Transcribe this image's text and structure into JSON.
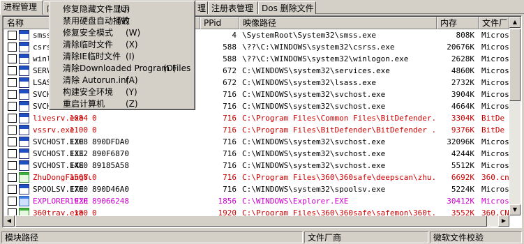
{
  "tabs": [
    {
      "label": "进程管理",
      "active": true
    },
    {
      "label": "内"
    },
    {
      "label": "理"
    },
    {
      "label": "注册表管理"
    },
    {
      "label": "Dos 删除文件"
    }
  ],
  "columns": [
    "名称",
    "PPid",
    "映像路径",
    "内存",
    "文件厂"
  ],
  "processes": [
    {
      "name": "smss.",
      "pid": "",
      "ppid": "4",
      "path": "\\SystemRoot\\System32\\smss.exe",
      "mem": "808K",
      "vendor": "Micros",
      "color": "#000000",
      "icon": "sys"
    },
    {
      "name": "csrss",
      "pid": "",
      "ppid": "588",
      "path": "\\??\\C:\\WINDOWS\\system32\\csrss.exe",
      "mem": "20676K",
      "vendor": "Micros",
      "color": "#000000",
      "icon": "sys"
    },
    {
      "name": "winlo",
      "pid": "",
      "ppid": "588",
      "path": "\\??\\C:\\WINDOWS\\system32\\winlogon.exe",
      "mem": "2628K",
      "vendor": "Micros",
      "color": "#000000",
      "icon": "sys"
    },
    {
      "name": "SERVI",
      "pid": "",
      "ppid": "672",
      "path": "C:\\WINDOWS\\system32\\services.exe",
      "mem": "4860K",
      "vendor": "Micros",
      "color": "#000000",
      "icon": "sys"
    },
    {
      "name": "LSASS",
      "pid": "",
      "ppid": "672",
      "path": "C:\\WINDOWS\\system32\\lsass.exe",
      "mem": "2732K",
      "vendor": "Micros",
      "color": "#000000",
      "icon": "sys"
    },
    {
      "name": "SVCHO",
      "pid": "",
      "ppid": "716",
      "path": "C:\\WINDOWS\\system32\\svchost.exe",
      "mem": "3904K",
      "vendor": "Micros",
      "color": "#000000",
      "icon": "sys"
    },
    {
      "name": "SVCHO",
      "pid": "",
      "ppid": "716",
      "path": "C:\\WINDOWS\\system32\\svchost.exe",
      "mem": "4664K",
      "vendor": "Micros",
      "color": "#000000",
      "icon": "sys"
    },
    {
      "name": "livesrv.exe",
      "pid": "1084",
      "handle": "0",
      "ppid": "716",
      "path": "C:\\Program Files\\Common Files\\BitDefender...",
      "mem": "3304K",
      "vendor": "BitDe",
      "color": "#cc0000",
      "icon": "sys"
    },
    {
      "name": "vssrv.exe",
      "pid": "1100",
      "handle": "0",
      "ppid": "716",
      "path": "C:\\Program Files\\BitDefender\\BitDefender ...",
      "mem": "9376K",
      "vendor": "BitDe",
      "color": "#cc0000",
      "icon": "sys"
    },
    {
      "name": "SVCHOST.EXE",
      "pid": "1208",
      "handle": "890DFDA0",
      "ppid": "716",
      "path": "C:\\WINDOWS\\system32\\svchost.exe",
      "mem": "32096K",
      "vendor": "Micros",
      "color": "#000000",
      "icon": "sys"
    },
    {
      "name": "SVCHOST.EXE",
      "pid": "1332",
      "handle": "890F6870",
      "ppid": "716",
      "path": "C:\\WINDOWS\\system32\\svchost.exe",
      "mem": "4244K",
      "vendor": "Micros",
      "color": "#000000",
      "icon": "sys"
    },
    {
      "name": "SVCHOST.EXE",
      "pid": "1480",
      "handle": "89185A58",
      "ppid": "716",
      "path": "C:\\WINDOWS\\system32\\svchost.exe",
      "mem": "5512K",
      "vendor": "Micros",
      "color": "#000000",
      "icon": "sys"
    },
    {
      "name": "ZhuDongFangYu.exe",
      "pid": "1508",
      "handle": "0",
      "ppid": "716",
      "path": "C:\\Program Files\\360\\360safe\\deepscan\\zhu...",
      "mem": "6692K",
      "vendor": "360.cn",
      "color": "#cc0000",
      "icon": "green"
    },
    {
      "name": "SPOOLSV.EXE",
      "pid": "1700",
      "handle": "890D46A0",
      "ppid": "716",
      "path": "C:\\WINDOWS\\system32\\spoolsv.exe",
      "mem": "5224K",
      "vendor": "Micros",
      "color": "#000000",
      "icon": "sys"
    },
    {
      "name": "EXPLORER.EXE",
      "pid": "1920",
      "handle": "89066248",
      "ppid": "1856",
      "path": "C:\\WINDOWS\\Explorer.EXE",
      "mem": "30412K",
      "vendor": "Micros",
      "color": "#cc00cc",
      "icon": "blue"
    },
    {
      "name": "360tray.exe",
      "pid": "180",
      "handle": "0",
      "ppid": "1920",
      "path": "C:\\Program Files\\360\\360safe\\safemon\\360t...",
      "mem": "3552K",
      "vendor": "360.CN",
      "color": "#cc0000",
      "icon": "green"
    }
  ],
  "context_menu": [
    {
      "label": "修复隐藏文件显示",
      "key": "(U)"
    },
    {
      "label": "禁用硬盘自动播放",
      "key": "(V)"
    },
    {
      "label": "修复安全模式",
      "key": "(W)"
    },
    {
      "label": "清除临时文件",
      "key": "(X)"
    },
    {
      "label": "清除IE临时文件",
      "key": "(I)"
    },
    {
      "label": "清除Downloaded Program Files",
      "key": "(D)"
    },
    {
      "label": "清除 Autorun.inf",
      "key": "(A)"
    },
    {
      "label": "构建安全环境",
      "key": "(Y)"
    },
    {
      "label": "重启计算机",
      "key": "(Z)"
    }
  ],
  "status": [
    "模块路径",
    "文件厂商",
    "微软文件校验"
  ]
}
